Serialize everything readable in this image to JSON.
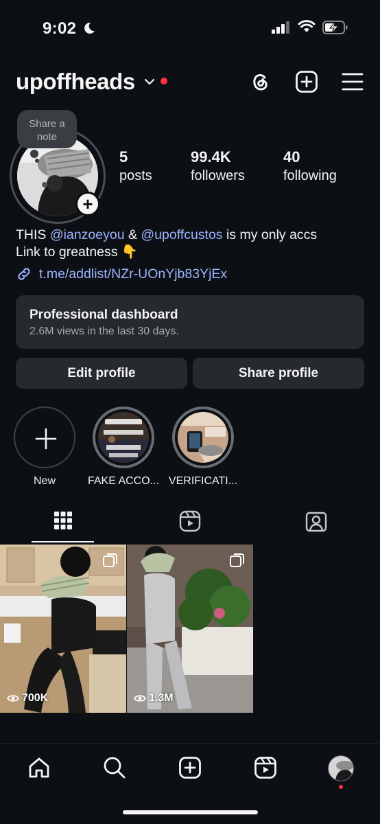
{
  "status_bar": {
    "time": "9:02",
    "icons": [
      "moon-icon",
      "signal-icon",
      "wifi-icon",
      "battery-charging-icon"
    ]
  },
  "header": {
    "username": "upoffheads",
    "icons": [
      "chevron-down-icon",
      "threads-icon",
      "create-icon",
      "menu-icon"
    ]
  },
  "note": {
    "text_line1": "Share a",
    "text_line2": "note"
  },
  "stats": [
    {
      "value": "5",
      "label": "posts"
    },
    {
      "value": "99.4K",
      "label": "followers"
    },
    {
      "value": "40",
      "label": "following"
    }
  ],
  "bio": {
    "line1_prefix": "THIS ",
    "mention1": "@ianzoeyou",
    "line1_mid": " & ",
    "mention2": "@upoffcustos",
    "line1_suffix": " is my only accs",
    "line2": "Link to greatness 👇",
    "link": "t.me/addlist/NZr-UOnYjb83YjEx"
  },
  "dashboard": {
    "title": "Professional dashboard",
    "subtitle": "2.6M views in the last 30 days."
  },
  "buttons": {
    "edit": "Edit profile",
    "share": "Share profile"
  },
  "highlights": [
    {
      "label": "New"
    },
    {
      "label": "FAKE ACCO..."
    },
    {
      "label": "VERIFICATI..."
    }
  ],
  "tabs": [
    "grid-icon",
    "reels-icon",
    "tagged-icon"
  ],
  "posts": [
    {
      "views": "700K"
    },
    {
      "views": "1.3M"
    }
  ],
  "bottom_nav": [
    "home-icon",
    "search-icon",
    "create-icon",
    "reels-icon",
    "profile-avatar"
  ],
  "colors": {
    "background": "#0c1014",
    "accent_link": "#9db2ff",
    "notification": "#ff3040",
    "card": "#262a2f"
  }
}
